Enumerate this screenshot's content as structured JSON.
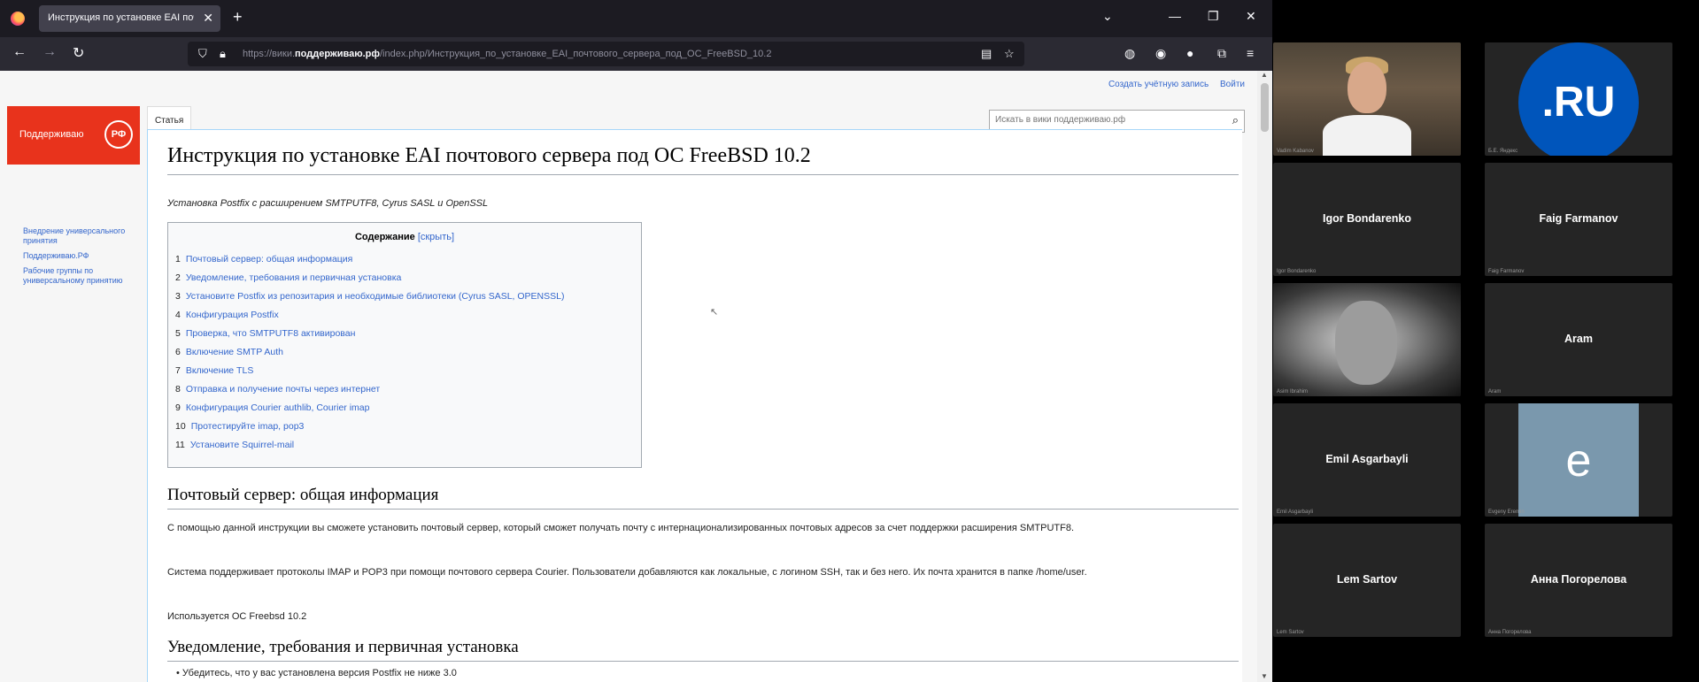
{
  "browser": {
    "tab_title": "Инструкция по установке EAI почт",
    "url_prefix": "https://вики.",
    "url_domain": "поддерживаю.рф",
    "url_path": "/index.php/Инструкция_по_установке_EAI_почтового_сервера_под_ОС_FreeBSD_10.2"
  },
  "page": {
    "personal_links": [
      "Создать учётную запись",
      "Войти"
    ],
    "logo_text": "Поддерживаю",
    "logo_badge": "РФ",
    "sidebar_links": [
      "Внедрение универсального принятия",
      "Поддерживаю.РФ",
      "Рабочие группы по универсальному принятию"
    ],
    "tab_article": "Статья",
    "search_placeholder": "Искать в вики поддерживаю.рф",
    "title": "Инструкция по установке EAI почтового сервера под ОС FreeBSD 10.2",
    "subtitle": "Установка Postfix с расширением SMTPUTF8, Cyrus SASL и OpenSSL",
    "toc": {
      "title": "Содержание",
      "hide": "[скрыть]",
      "items": [
        {
          "num": "1",
          "label": "Почтовый сервер: общая информация"
        },
        {
          "num": "2",
          "label": "Уведомление, требования и первичная установка"
        },
        {
          "num": "3",
          "label": "Установите Postfix из репозитария и необходимые библиотеки (Cyrus SASL, OPENSSL)"
        },
        {
          "num": "4",
          "label": "Конфигурация Postfix"
        },
        {
          "num": "5",
          "label": "Проверка, что SMTPUTF8 активирован"
        },
        {
          "num": "6",
          "label": "Включение SMTP Auth"
        },
        {
          "num": "7",
          "label": "Включение TLS"
        },
        {
          "num": "8",
          "label": "Отправка и получение почты через интернет"
        },
        {
          "num": "9",
          "label": "Конфигурация Courier authlib, Courier imap"
        },
        {
          "num": "10",
          "label": "Протестируйте imap, pop3"
        },
        {
          "num": "11",
          "label": "Установите Squirrel-mail"
        }
      ]
    },
    "section1": {
      "heading": "Почтовый сервер: общая информация",
      "p1": "С помощью данной инструкции вы сможете установить почтовый сервер, который сможет получать почту с интернационализированных почтовых адресов за счет поддержки расширения SMTPUTF8.",
      "p2": "Система поддерживает протоколы IMAP и POP3 при помощи почтового сервера Courier. Пользователи добавляются как локальные, с логином SSH, так и без него. Их почта хранится в папке /home/user.",
      "p3": "Используется ОС Freebsd 10.2"
    },
    "section2": {
      "heading": "Уведомление, требования и первичная установка",
      "bullet1": "Убедитесь, что у вас установлена версия Postfix не ниже 3.0"
    }
  },
  "call": {
    "participants": [
      {
        "name": "",
        "label": "Vadim Kabanov",
        "type": "video"
      },
      {
        "name": "",
        "label": "Б.Е. Яндекс",
        "type": "logo",
        "logo_text": ".RU"
      },
      {
        "name": "Igor Bondarenko",
        "label": "Igor Bondarenko"
      },
      {
        "name": "Faig Farmanov",
        "label": "Faig Farmanov"
      },
      {
        "name": "",
        "label": "Asim Ibrahim",
        "type": "photo"
      },
      {
        "name": "Aram",
        "label": "Aram"
      },
      {
        "name": "Emil Asgarbayli",
        "label": "Emil Asgarbayli"
      },
      {
        "name": "",
        "label": "Evgeny Eremin",
        "type": "avatar",
        "avatar_letter": "e"
      },
      {
        "name": "Lem Sartov",
        "label": "Lem Sartov"
      },
      {
        "name": "Анна Погорелова",
        "label": "Анна Погорелова"
      }
    ]
  },
  "colors": {
    "link": "#3366cc",
    "logo_red": "#e8331c",
    "ru_blue": "#0055bb",
    "avatar_bg": "#7a98ad"
  }
}
